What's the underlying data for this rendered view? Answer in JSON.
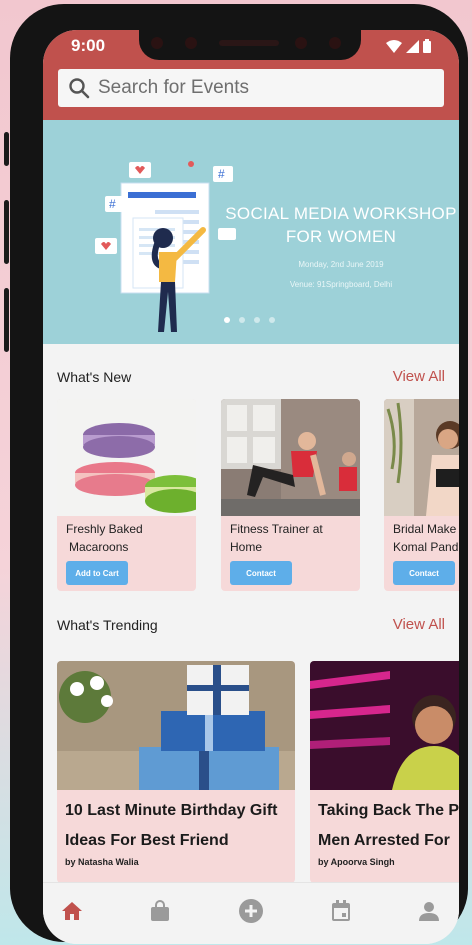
{
  "status_bar": {
    "time": "9:00"
  },
  "search": {
    "placeholder": "Search for Events"
  },
  "banner": {
    "title": "SOCIAL MEDIA WORKSHOP FOR WOMEN",
    "date": "Monday, 2nd June 2019",
    "venue": "Venue: 91Springboard, Delhi",
    "slide_count": 4,
    "active_slide": 1
  },
  "whats_new": {
    "title": "What's New",
    "view_all": "View All",
    "cards": [
      {
        "title_line1": "Freshly Baked",
        "title_line2": "Macaroons",
        "button": "Add to Cart"
      },
      {
        "title_line1": "Fitness Trainer at",
        "title_line2": "Home",
        "button": "Contact"
      },
      {
        "title_line1": "Bridal Make",
        "title_line2": "Komal Pand",
        "button": "Contact"
      }
    ]
  },
  "whats_trending": {
    "title": "What's Trending",
    "view_all": "View All",
    "cards": [
      {
        "title_line1": "10 Last Minute Birthday Gift",
        "title_line2": "Ideas For Best Friend",
        "author": "by Natasha Walia"
      },
      {
        "title_line1": "Taking Back The Po",
        "title_line2": "Men Arrested For",
        "author": "by Apoorva Singh"
      }
    ]
  },
  "bottom_nav": {
    "items": [
      "home",
      "bag",
      "add",
      "calendar",
      "profile"
    ],
    "active": "home"
  },
  "colors": {
    "accent": "#c0514d",
    "button": "#5eaee9",
    "card_bg": "#f6d9d9",
    "banner_bg": "#9dd1d8"
  }
}
